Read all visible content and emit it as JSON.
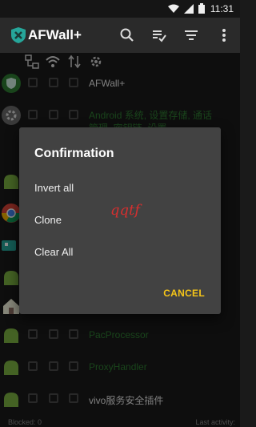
{
  "status_bar": {
    "time": "11:31"
  },
  "app": {
    "title": "AFWall+"
  },
  "list": {
    "rows": [
      {
        "name": "AFWall+",
        "highlight": false
      },
      {
        "name": "Android 系统, 设置存储, 通话管理, 密钥链, 设置",
        "highlight": true
      },
      {
        "name": "",
        "highlight": false
      },
      {
        "name": "",
        "highlight": false
      },
      {
        "name": "",
        "highlight": false
      },
      {
        "name": "",
        "highlight": false
      },
      {
        "name": "",
        "highlight": false
      },
      {
        "name": "PacProcessor",
        "highlight": true
      },
      {
        "name": "ProxyHandler",
        "highlight": true
      },
      {
        "name": "vivo服务安全插件",
        "highlight": false
      }
    ]
  },
  "footer": {
    "blocked": "Blocked: 0",
    "last_activity": "Last activity:"
  },
  "dialog": {
    "title": "Confirmation",
    "options": [
      "Invert all",
      "Clone",
      "Clear All"
    ],
    "watermark": "qqtf",
    "cancel_label": "CANCEL"
  },
  "colors": {
    "accent_green": "#2e7d32",
    "accent_yellow": "#f5c518"
  }
}
